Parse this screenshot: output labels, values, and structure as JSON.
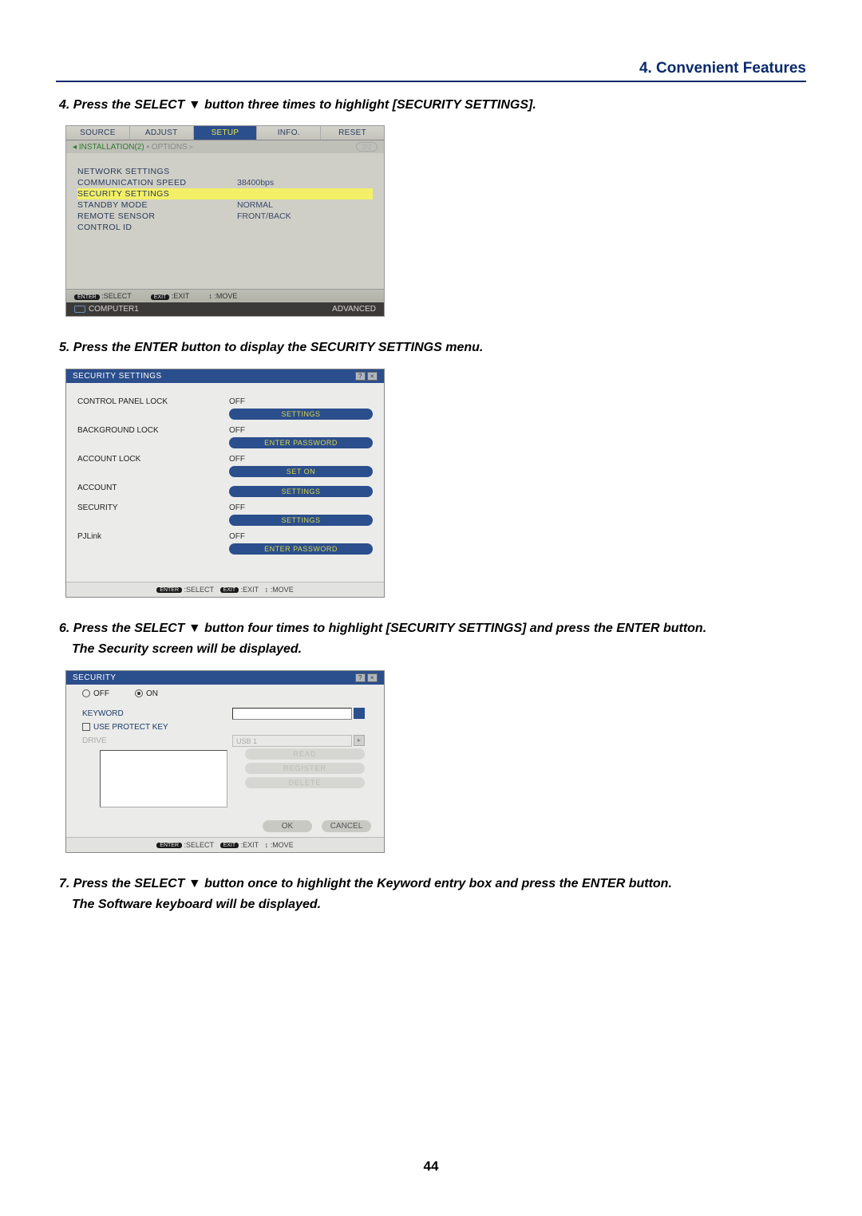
{
  "header": {
    "section": "4. Convenient Features"
  },
  "steps": {
    "s4": "4.  Press the SELECT ▼ button three times to highlight [SECURITY SETTINGS].",
    "s5": "5.  Press the ENTER button to display the SECURITY SETTINGS menu.",
    "s6a": "6.  Press the SELECT ▼ button four times to highlight [SECURITY SETTINGS] and press the ENTER button.",
    "s6b": "The Security screen will be displayed.",
    "s7a": "7. Press the SELECT ▼ button once to highlight the Keyword entry box and press the ENTER button.",
    "s7b": "The Software keyboard will be displayed."
  },
  "osd1": {
    "tabs": [
      "SOURCE",
      "ADJUST",
      "SETUP",
      "INFO.",
      "RESET"
    ],
    "active_tab": "SETUP",
    "subtabs": {
      "left": "INSTALLATION(2)",
      "right": "OPTIONS",
      "page": "2/2"
    },
    "rows": [
      {
        "label": "NETWORK SETTINGS",
        "value": ""
      },
      {
        "label": "COMMUNICATION SPEED",
        "value": "38400bps"
      },
      {
        "label": "SECURITY SETTINGS",
        "value": "",
        "highlight": true
      },
      {
        "label": "STANDBY MODE",
        "value": "NORMAL"
      },
      {
        "label": "REMOTE SENSOR",
        "value": "FRONT/BACK"
      },
      {
        "label": "CONTROL ID",
        "value": ""
      }
    ],
    "footer": [
      {
        "key": "ENTER",
        "label": ":SELECT"
      },
      {
        "key": "EXIT",
        "label": ":EXIT"
      },
      {
        "key": "↕",
        "label": ":MOVE"
      }
    ],
    "status_left": "COMPUTER1",
    "status_right": "ADVANCED"
  },
  "osd2": {
    "title": "SECURITY SETTINGS",
    "rows": [
      {
        "label": "CONTROL PANEL LOCK",
        "value": "OFF",
        "btn": "SETTINGS"
      },
      {
        "label": "BACKGROUND LOCK",
        "value": "OFF",
        "btn": "ENTER PASSWORD"
      },
      {
        "label": "ACCOUNT LOCK",
        "value": "OFF",
        "btn": "SET ON"
      },
      {
        "label": "ACCOUNT",
        "value": "",
        "btn": "SETTINGS"
      },
      {
        "label": "SECURITY",
        "value": "OFF",
        "btn": "SETTINGS"
      },
      {
        "label": "PJLink",
        "value": "OFF",
        "btn": "ENTER PASSWORD"
      }
    ],
    "footer": [
      {
        "key": "ENTER",
        "label": ":SELECT"
      },
      {
        "key": "EXIT",
        "label": ":EXIT"
      },
      {
        "key": "↕",
        "label": ":MOVE"
      }
    ]
  },
  "osd3": {
    "title": "SECURITY",
    "radio_off": "OFF",
    "radio_on": "ON",
    "keyword_label": "KEYWORD",
    "protect_label": "USE PROTECT KEY",
    "drive_label": "DRIVE",
    "drive_value": "USB 1",
    "buttons": [
      "READ",
      "REGISTER",
      "DELETE"
    ],
    "ok": "OK",
    "cancel": "CANCEL",
    "footer": [
      {
        "key": "ENTER",
        "label": ":SELECT"
      },
      {
        "key": "EXIT",
        "label": ":EXIT"
      },
      {
        "key": "↕",
        "label": ":MOVE"
      }
    ]
  },
  "page_number": "44"
}
